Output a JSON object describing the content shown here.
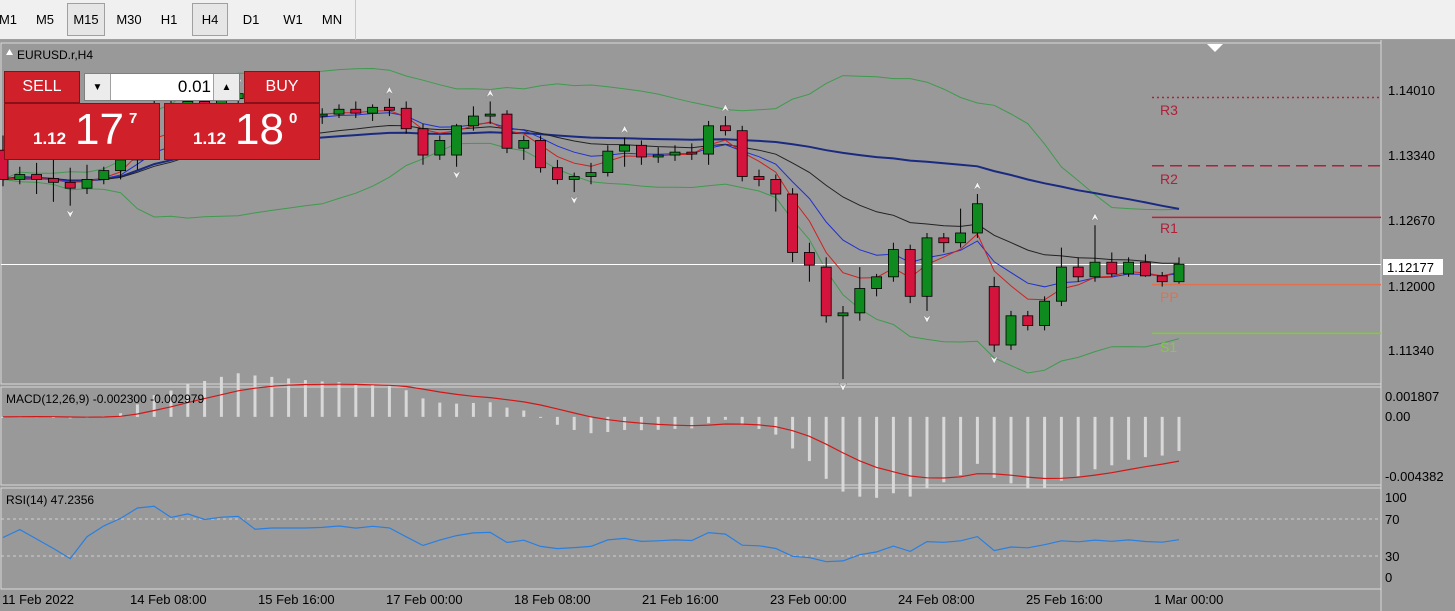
{
  "timeframes": [
    {
      "label": "M1",
      "active": false
    },
    {
      "label": "M5",
      "active": false
    },
    {
      "label": "M15",
      "active": true
    },
    {
      "label": "M30",
      "active": false
    },
    {
      "label": "H1",
      "active": false
    },
    {
      "label": "H4",
      "active": true
    },
    {
      "label": "D1",
      "active": false
    },
    {
      "label": "W1",
      "active": false
    },
    {
      "label": "MN",
      "active": false
    }
  ],
  "chart": {
    "symbol_label": "EURUSD.r,H4",
    "current_price": "1.12177",
    "price_ticks": [
      "1.14010",
      "1.13340",
      "1.12670",
      "1.12000",
      "1.11340"
    ],
    "pivot_labels": [
      "R3",
      "R2",
      "R1",
      "PP",
      "S1"
    ],
    "time_labels": [
      "11 Feb 2022",
      "14 Feb 08:00",
      "15 Feb 16:00",
      "17 Feb 00:00",
      "18 Feb 08:00",
      "21 Feb 16:00",
      "23 Feb 00:00",
      "24 Feb 08:00",
      "25 Feb 16:00",
      "1 Mar 00:00"
    ]
  },
  "trade": {
    "sell_label": "SELL",
    "buy_label": "BUY",
    "volume": "0.01",
    "sell_price": {
      "prefix": "1.12",
      "big": "17",
      "sup": "7"
    },
    "buy_price": {
      "prefix": "1.12",
      "big": "18",
      "sup": "0"
    }
  },
  "macd": {
    "label": "MACD(12,26,9) -0.002300 -0.002979",
    "ticks": [
      "0.001807",
      "0.00",
      "-0.004382"
    ]
  },
  "rsi": {
    "label": "RSI(14) 47.2356",
    "ticks": [
      "100",
      "70",
      "30",
      "0"
    ]
  },
  "chart_data": {
    "type": "candlestick",
    "symbol": "EURUSD.r",
    "timeframe": "H4",
    "ylim": [
      1.1095,
      1.1445
    ],
    "x_labels": [
      "11 Feb 2022",
      "14 Feb 08:00",
      "15 Feb 16:00",
      "17 Feb 00:00",
      "18 Feb 08:00",
      "21 Feb 16:00",
      "23 Feb 00:00",
      "24 Feb 08:00",
      "25 Feb 16:00",
      "1 Mar 00:00"
    ],
    "y_ticks": [
      1.1401,
      1.1334,
      1.1267,
      1.12,
      1.1134
    ],
    "current_price": 1.12177,
    "pivots": [
      {
        "name": "R3",
        "value": 1.1389
      },
      {
        "name": "R2",
        "value": 1.1319
      },
      {
        "name": "R1",
        "value": 1.1266
      },
      {
        "name": "PP",
        "value": 1.1197
      },
      {
        "name": "S1",
        "value": 1.1147
      }
    ],
    "candles": [
      {
        "o": 1.1335,
        "h": 1.135,
        "l": 1.1298,
        "c": 1.1305
      },
      {
        "o": 1.1305,
        "h": 1.1318,
        "l": 1.13,
        "c": 1.131
      },
      {
        "o": 1.131,
        "h": 1.1322,
        "l": 1.129,
        "c": 1.1305
      },
      {
        "o": 1.1306,
        "h": 1.1325,
        "l": 1.1282,
        "c": 1.1302
      },
      {
        "o": 1.1302,
        "h": 1.1317,
        "l": 1.1278,
        "c": 1.1296
      },
      {
        "o": 1.1296,
        "h": 1.132,
        "l": 1.129,
        "c": 1.1305
      },
      {
        "o": 1.1305,
        "h": 1.1318,
        "l": 1.13,
        "c": 1.1314
      },
      {
        "o": 1.1314,
        "h": 1.134,
        "l": 1.1305,
        "c": 1.1325
      },
      {
        "o": 1.1325,
        "h": 1.138,
        "l": 1.1315,
        "c": 1.1365
      },
      {
        "o": 1.1365,
        "h": 1.139,
        "l": 1.136,
        "c": 1.138
      },
      {
        "o": 1.138,
        "h": 1.1392,
        "l": 1.1355,
        "c": 1.1365
      },
      {
        "o": 1.1365,
        "h": 1.1392,
        "l": 1.1358,
        "c": 1.1385
      },
      {
        "o": 1.1385,
        "h": 1.1395,
        "l": 1.1372,
        "c": 1.1375
      },
      {
        "o": 1.1375,
        "h": 1.1392,
        "l": 1.137,
        "c": 1.1388
      },
      {
        "o": 1.1388,
        "h": 1.14,
        "l": 1.1375,
        "c": 1.1393
      },
      {
        "o": 1.139,
        "h": 1.1395,
        "l": 1.1338,
        "c": 1.1365
      },
      {
        "o": 1.1365,
        "h": 1.1378,
        "l": 1.1355,
        "c": 1.137
      },
      {
        "o": 1.137,
        "h": 1.1388,
        "l": 1.136,
        "c": 1.137
      },
      {
        "o": 1.137,
        "h": 1.138,
        "l": 1.1362,
        "c": 1.137
      },
      {
        "o": 1.137,
        "h": 1.1378,
        "l": 1.1362,
        "c": 1.1372
      },
      {
        "o": 1.1372,
        "h": 1.1382,
        "l": 1.1368,
        "c": 1.1377
      },
      {
        "o": 1.1377,
        "h": 1.1385,
        "l": 1.1368,
        "c": 1.1373
      },
      {
        "o": 1.1373,
        "h": 1.1382,
        "l": 1.1365,
        "c": 1.1379
      },
      {
        "o": 1.1379,
        "h": 1.1388,
        "l": 1.137,
        "c": 1.1376
      },
      {
        "o": 1.1378,
        "h": 1.1385,
        "l": 1.1352,
        "c": 1.1357
      },
      {
        "o": 1.1357,
        "h": 1.1362,
        "l": 1.132,
        "c": 1.133
      },
      {
        "o": 1.133,
        "h": 1.135,
        "l": 1.1325,
        "c": 1.1345
      },
      {
        "o": 1.133,
        "h": 1.1362,
        "l": 1.1318,
        "c": 1.136
      },
      {
        "o": 1.136,
        "h": 1.138,
        "l": 1.1355,
        "c": 1.137
      },
      {
        "o": 1.137,
        "h": 1.1385,
        "l": 1.1362,
        "c": 1.1372
      },
      {
        "o": 1.1372,
        "h": 1.1376,
        "l": 1.1332,
        "c": 1.1337
      },
      {
        "o": 1.1337,
        "h": 1.135,
        "l": 1.1325,
        "c": 1.1345
      },
      {
        "o": 1.1345,
        "h": 1.135,
        "l": 1.1312,
        "c": 1.1317
      },
      {
        "o": 1.1317,
        "h": 1.1325,
        "l": 1.13,
        "c": 1.1305
      },
      {
        "o": 1.1305,
        "h": 1.1312,
        "l": 1.1292,
        "c": 1.1308
      },
      {
        "o": 1.1308,
        "h": 1.1322,
        "l": 1.13,
        "c": 1.1312
      },
      {
        "o": 1.1312,
        "h": 1.134,
        "l": 1.1308,
        "c": 1.1334
      },
      {
        "o": 1.1334,
        "h": 1.1348,
        "l": 1.1318,
        "c": 1.134
      },
      {
        "o": 1.134,
        "h": 1.1345,
        "l": 1.132,
        "c": 1.1328
      },
      {
        "o": 1.1328,
        "h": 1.1338,
        "l": 1.1322,
        "c": 1.133
      },
      {
        "o": 1.133,
        "h": 1.134,
        "l": 1.1324,
        "c": 1.1333
      },
      {
        "o": 1.1333,
        "h": 1.1342,
        "l": 1.1325,
        "c": 1.1331
      },
      {
        "o": 1.1331,
        "h": 1.1365,
        "l": 1.132,
        "c": 1.136
      },
      {
        "o": 1.136,
        "h": 1.137,
        "l": 1.135,
        "c": 1.1355
      },
      {
        "o": 1.1355,
        "h": 1.136,
        "l": 1.1303,
        "c": 1.1308
      },
      {
        "o": 1.1308,
        "h": 1.1315,
        "l": 1.1298,
        "c": 1.1305
      },
      {
        "o": 1.1305,
        "h": 1.131,
        "l": 1.1272,
        "c": 1.129
      },
      {
        "o": 1.129,
        "h": 1.1296,
        "l": 1.122,
        "c": 1.123
      },
      {
        "o": 1.123,
        "h": 1.124,
        "l": 1.12,
        "c": 1.1217
      },
      {
        "o": 1.1215,
        "h": 1.1225,
        "l": 1.1158,
        "c": 1.1165
      },
      {
        "o": 1.1165,
        "h": 1.1175,
        "l": 1.11,
        "c": 1.1168
      },
      {
        "o": 1.1168,
        "h": 1.1215,
        "l": 1.116,
        "c": 1.1193
      },
      {
        "o": 1.1193,
        "h": 1.1208,
        "l": 1.1185,
        "c": 1.1205
      },
      {
        "o": 1.1205,
        "h": 1.124,
        "l": 1.12,
        "c": 1.1233
      },
      {
        "o": 1.1233,
        "h": 1.1238,
        "l": 1.1178,
        "c": 1.1185
      },
      {
        "o": 1.1185,
        "h": 1.125,
        "l": 1.117,
        "c": 1.1245
      },
      {
        "o": 1.1245,
        "h": 1.125,
        "l": 1.123,
        "c": 1.124
      },
      {
        "o": 1.124,
        "h": 1.1275,
        "l": 1.1235,
        "c": 1.125
      },
      {
        "o": 1.125,
        "h": 1.129,
        "l": 1.1245,
        "c": 1.128
      },
      {
        "o": 1.1195,
        "h": 1.1205,
        "l": 1.1128,
        "c": 1.1135
      },
      {
        "o": 1.1135,
        "h": 1.117,
        "l": 1.113,
        "c": 1.1165
      },
      {
        "o": 1.1165,
        "h": 1.117,
        "l": 1.115,
        "c": 1.1155
      },
      {
        "o": 1.1155,
        "h": 1.1185,
        "l": 1.115,
        "c": 1.118
      },
      {
        "o": 1.118,
        "h": 1.1235,
        "l": 1.1175,
        "c": 1.1215
      },
      {
        "o": 1.1215,
        "h": 1.1225,
        "l": 1.12,
        "c": 1.1205
      },
      {
        "o": 1.1205,
        "h": 1.1258,
        "l": 1.12,
        "c": 1.122
      },
      {
        "o": 1.122,
        "h": 1.123,
        "l": 1.1205,
        "c": 1.1208
      },
      {
        "o": 1.1208,
        "h": 1.1225,
        "l": 1.1205,
        "c": 1.122
      },
      {
        "o": 1.122,
        "h": 1.1228,
        "l": 1.1205,
        "c": 1.1206
      },
      {
        "o": 1.1206,
        "h": 1.121,
        "l": 1.1195,
        "c": 1.12
      },
      {
        "o": 1.12,
        "h": 1.1225,
        "l": 1.1198,
        "c": 1.1218
      }
    ],
    "macd": {
      "name": "MACD(12,26,9)",
      "main": -0.0023,
      "signal": -0.002979,
      "ylim": [
        -0.004382,
        0.001807
      ]
    },
    "rsi": {
      "name": "RSI(14)",
      "value": 47.2356,
      "ylim": [
        0,
        100
      ],
      "levels": [
        70,
        30
      ]
    }
  }
}
